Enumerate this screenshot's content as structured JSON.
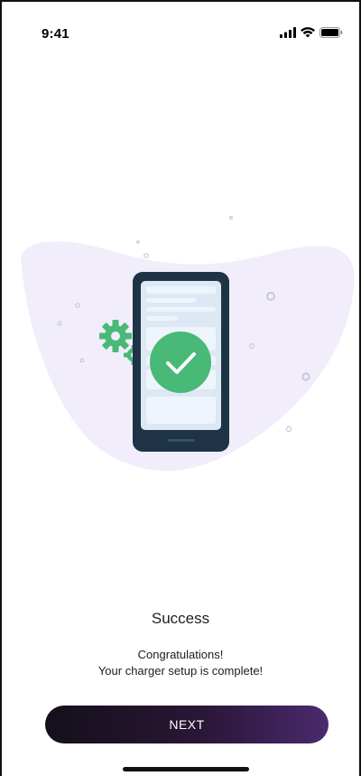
{
  "status_bar": {
    "time": "9:41",
    "icons": [
      "signal-icon",
      "wifi-icon",
      "battery-icon"
    ]
  },
  "illustration": {
    "subject": "phone-with-checkmark",
    "colors": {
      "blob": "#f1edfb",
      "phone_frame": "#1e3346",
      "screen": "#dfe9f5",
      "check_circle": "#48b977",
      "gear": "#48b977"
    }
  },
  "content": {
    "title": "Success",
    "message_line1": "Congratulations!",
    "message_line2": "Your charger setup is complete!"
  },
  "actions": {
    "next_label": "NEXT"
  }
}
